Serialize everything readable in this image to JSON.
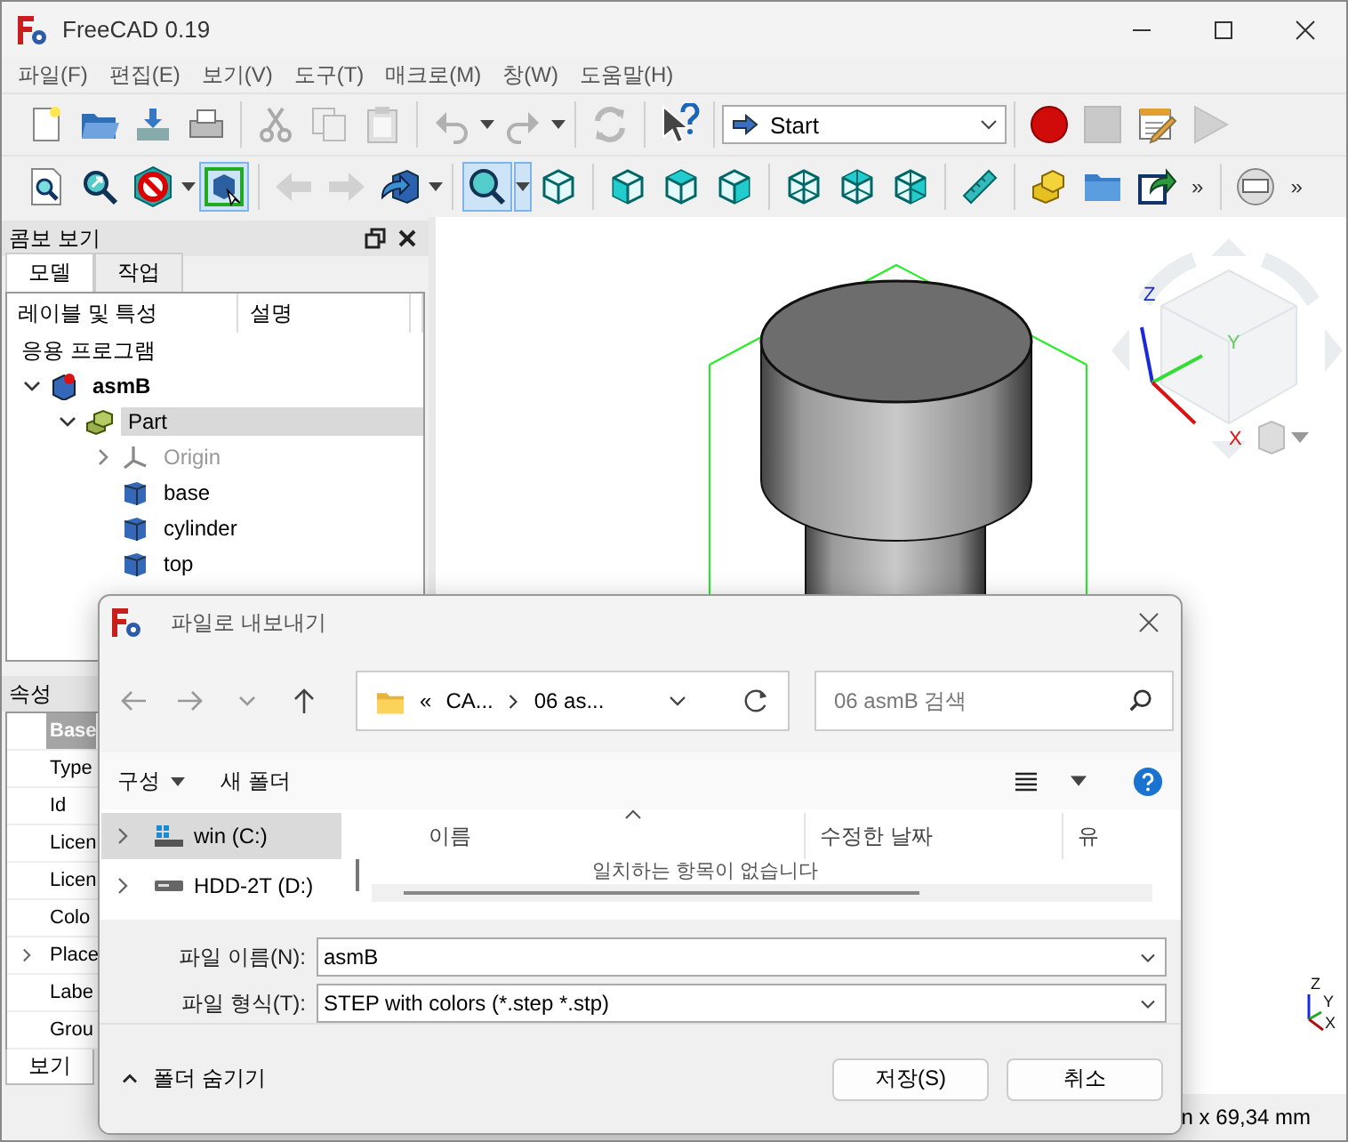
{
  "window": {
    "title": "FreeCAD 0.19"
  },
  "menu": [
    "파일(F)",
    "편집(E)",
    "보기(V)",
    "도구(T)",
    "매크로(M)",
    "창(W)",
    "도움말(H)"
  ],
  "toolbars": [
    {
      "items": [
        {
          "kind": "new",
          "disabled": false,
          "selected": false
        },
        {
          "kind": "open",
          "disabled": false,
          "selected": false
        },
        {
          "kind": "import",
          "disabled": false,
          "selected": false
        },
        {
          "kind": "print",
          "disabled": false,
          "selected": false
        },
        {
          "kind": "sep"
        },
        {
          "kind": "cut",
          "disabled": true,
          "selected": false
        },
        {
          "kind": "copy",
          "disabled": true,
          "selected": false
        },
        {
          "kind": "paste",
          "disabled": true,
          "selected": false
        },
        {
          "kind": "sep"
        },
        {
          "kind": "undo",
          "disabled": true,
          "selected": false
        },
        {
          "kind": "caret",
          "selected": false
        },
        {
          "kind": "redo",
          "disabled": true,
          "selected": false
        },
        {
          "kind": "caret",
          "selected": false
        },
        {
          "kind": "sep"
        },
        {
          "kind": "refresh",
          "disabled": true,
          "selected": false
        },
        {
          "kind": "sep"
        },
        {
          "kind": "whatsthis",
          "disabled": false,
          "selected": false
        },
        {
          "kind": "sep"
        },
        {
          "kind": "combo",
          "value": "Start"
        },
        {
          "kind": "sep"
        },
        {
          "kind": "record",
          "disabled": false,
          "selected": false
        },
        {
          "kind": "stop",
          "disabled": true,
          "selected": false
        },
        {
          "kind": "macro",
          "disabled": false,
          "selected": false
        },
        {
          "kind": "play",
          "disabled": true,
          "selected": false
        }
      ]
    },
    {
      "items": [
        {
          "kind": "fitall",
          "disabled": false,
          "selected": false
        },
        {
          "kind": "fitsel",
          "disabled": false,
          "selected": false
        },
        {
          "kind": "drawstyle",
          "disabled": false,
          "selected": false
        },
        {
          "kind": "caret",
          "selected": false
        },
        {
          "kind": "boundbox",
          "disabled": false,
          "selected": true
        },
        {
          "kind": "sep"
        },
        {
          "kind": "back",
          "disabled": true,
          "selected": false
        },
        {
          "kind": "forward",
          "disabled": true,
          "selected": false
        },
        {
          "kind": "stdviews",
          "disabled": false,
          "selected": false
        },
        {
          "kind": "caret",
          "selected": false
        },
        {
          "kind": "sep"
        },
        {
          "kind": "zoom",
          "disabled": false,
          "selected": true
        },
        {
          "kind": "caret",
          "selected": true
        },
        {
          "kind": "iso",
          "disabled": false,
          "selected": false
        },
        {
          "kind": "sep"
        },
        {
          "kind": "front",
          "disabled": false,
          "selected": false
        },
        {
          "kind": "top",
          "disabled": false,
          "selected": false
        },
        {
          "kind": "right",
          "disabled": false,
          "selected": false
        },
        {
          "kind": "sep"
        },
        {
          "kind": "rear",
          "disabled": false,
          "selected": false
        },
        {
          "kind": "bottom",
          "disabled": false,
          "selected": false
        },
        {
          "kind": "left",
          "disabled": false,
          "selected": false
        },
        {
          "kind": "sep"
        },
        {
          "kind": "measure",
          "disabled": false,
          "selected": false
        },
        {
          "kind": "sep"
        },
        {
          "kind": "part",
          "disabled": false,
          "selected": false
        },
        {
          "kind": "folder",
          "disabled": false,
          "selected": false
        },
        {
          "kind": "export",
          "disabled": false,
          "selected": false
        },
        {
          "kind": "more",
          "text": "»"
        },
        {
          "kind": "sep"
        },
        {
          "kind": "view",
          "disabled": false,
          "selected": false
        },
        {
          "kind": "more",
          "text": "»"
        }
      ]
    }
  ],
  "combo_view": {
    "title": "콤보 보기",
    "tabs": [
      {
        "label": "모델",
        "selected": true
      },
      {
        "label": "작업",
        "selected": false
      }
    ],
    "tree": {
      "columns": [
        "레이블 및 특성",
        "설명"
      ],
      "root": "응용 프로그램",
      "items": [
        {
          "label": "asmB",
          "kind": "document",
          "expanded": true,
          "selected": false,
          "disabled": false,
          "children": [
            {
              "label": "Part",
              "kind": "part",
              "expanded": true,
              "selected": true,
              "disabled": false,
              "children": [
                {
                  "label": "Origin",
                  "kind": "origin",
                  "expanded": false,
                  "selected": false,
                  "disabled": true
                },
                {
                  "label": "base",
                  "kind": "solid",
                  "selected": false,
                  "disabled": false
                },
                {
                  "label": "cylinder",
                  "kind": "solid",
                  "selected": false,
                  "disabled": false
                },
                {
                  "label": "top",
                  "kind": "solid",
                  "selected": false,
                  "disabled": false
                }
              ]
            }
          ]
        }
      ]
    },
    "properties": {
      "title": "속성",
      "rows": [
        {
          "label": "Base",
          "kind": "group",
          "selected": true
        },
        {
          "label": "Type",
          "kind": "prop",
          "selected": false
        },
        {
          "label": "Id",
          "kind": "prop",
          "selected": false
        },
        {
          "label": "Licen",
          "kind": "prop",
          "selected": false
        },
        {
          "label": "Licen",
          "kind": "prop",
          "selected": false
        },
        {
          "label": "Colo",
          "kind": "prop",
          "selected": false
        },
        {
          "label": "Place",
          "kind": "prop",
          "selected": false,
          "expanded": false
        },
        {
          "label": "Labe",
          "kind": "prop",
          "selected": false
        },
        {
          "label": "Grou",
          "kind": "prop",
          "selected": false
        }
      ]
    },
    "bottom_tabs": [
      {
        "label": "보기",
        "selected": true
      }
    ]
  },
  "view3d": {
    "axis_labels": [
      "Z",
      "Y",
      "X"
    ],
    "mini_axis_labels": [
      "Z",
      "Y",
      "X"
    ]
  },
  "status_bar": {
    "text": "n x 69,34 mm"
  },
  "dialog": {
    "title": "파일로 내보내기",
    "address": {
      "overflow": "«",
      "segments": [
        "CA...",
        "06 as..."
      ]
    },
    "search": {
      "placeholder": "06 asmB 검색"
    },
    "commands": {
      "organize": "구성",
      "new_folder": "새 폴더"
    },
    "nav": [
      {
        "label": "win (C:)",
        "kind": "system",
        "selected": true
      },
      {
        "label": "HDD-2T (D:)",
        "kind": "hdd",
        "selected": false
      }
    ],
    "columns": [
      "이름",
      "수정한 날짜",
      "유"
    ],
    "empty_text": "일치하는 항목이 없습니다",
    "fields": [
      {
        "label": "파일 이름(N):",
        "value": "asmB"
      },
      {
        "label": "파일 형식(T):",
        "value": "STEP with colors (*.step *.stp)"
      }
    ],
    "hide_folders": "폴더 숨기기",
    "buttons": [
      "저장(S)",
      "취소"
    ]
  }
}
